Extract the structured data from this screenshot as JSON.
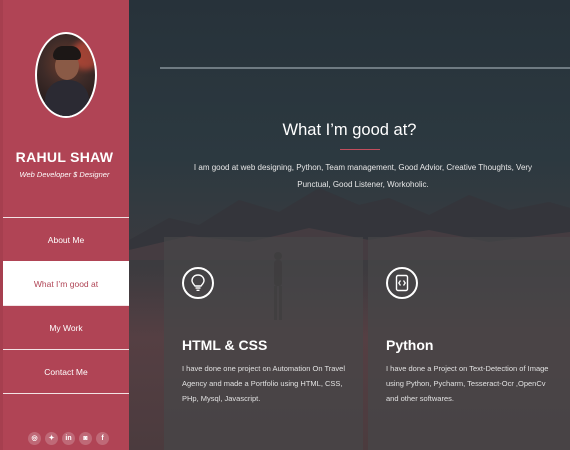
{
  "profile": {
    "name": "RAHUL SHAW",
    "role": "Web Developer $ Designer"
  },
  "nav": {
    "items": [
      {
        "label": "About Me",
        "active": false
      },
      {
        "label": "What I’m good at",
        "active": true
      },
      {
        "label": "My Work",
        "active": false
      },
      {
        "label": "Contact Me",
        "active": false
      }
    ]
  },
  "social": {
    "icons": [
      "github-icon",
      "twitter-icon",
      "linkedin-icon",
      "instagram-icon",
      "facebook-icon"
    ],
    "glyphs": [
      "◎",
      "✦",
      "in",
      "◙",
      "f"
    ]
  },
  "section": {
    "title": "What I’m good at?",
    "description": "I am good at web designing, Python, Team management, Good Advior, Creative Thoughts, Very Punctual, Good Listener, Workoholic."
  },
  "cards": [
    {
      "icon": "lightbulb-icon",
      "title": "HTML & CSS",
      "description": "I have done one project on Automation On Travel Agency and made a Portfolio using HTML, CSS, PHp, Mysql, Javascript."
    },
    {
      "icon": "code-icon",
      "title": "Python",
      "description": "I have done a Project on Text-Detection of Image using Python, Pycharm, Tesseract-Ocr ,OpenCv and other softwares."
    }
  ],
  "colors": {
    "sidebar": "#b04455",
    "accent": "#c24d5d",
    "text": "#ffffff"
  }
}
